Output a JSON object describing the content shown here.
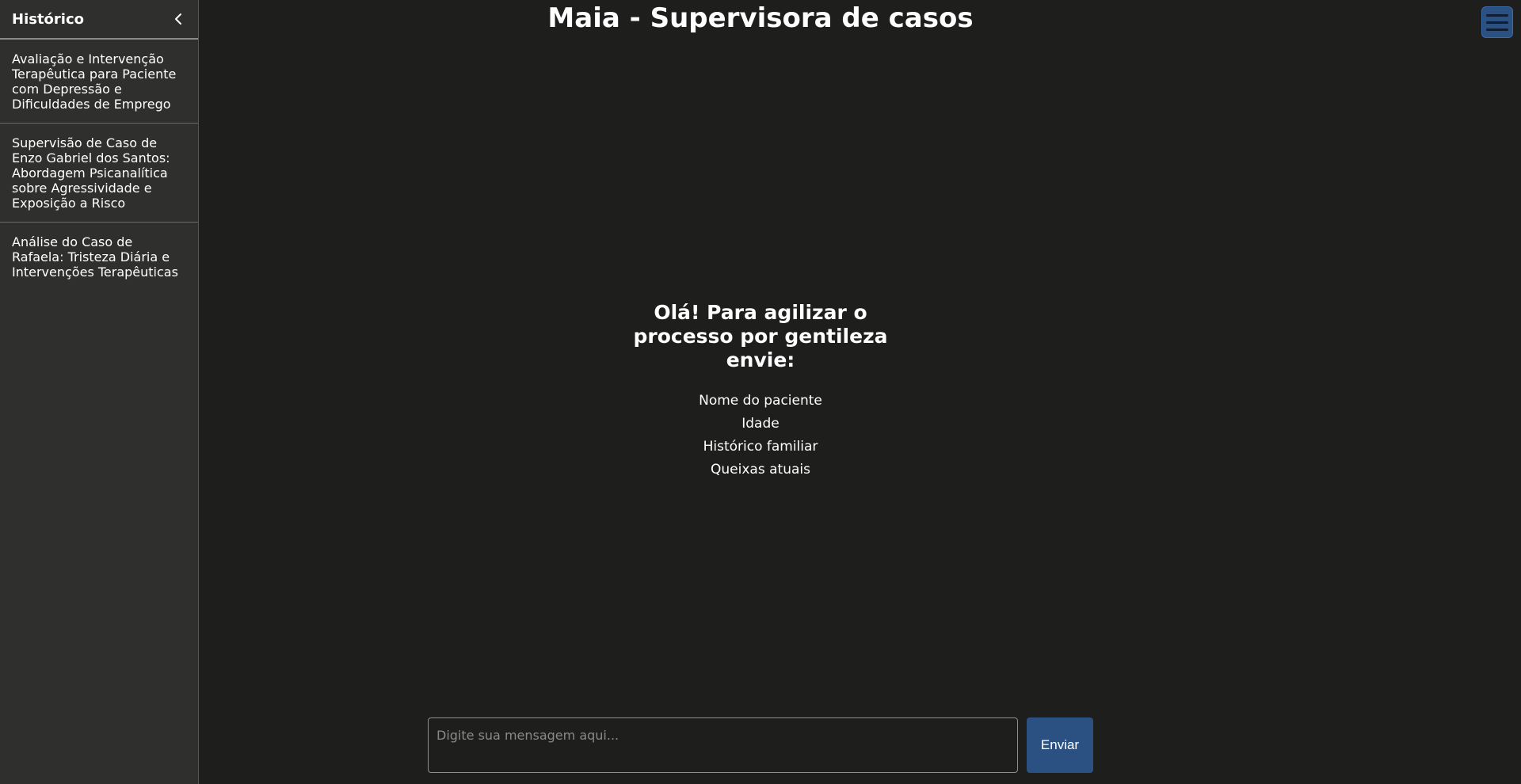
{
  "sidebar": {
    "title": "Histórico",
    "collapse_icon": "chevron-left-icon",
    "items": [
      {
        "label": "Avaliação e Intervenção Terapêutica para Paciente com Depressão e Dificuldades de Emprego"
      },
      {
        "label": "Supervisão de Caso de Enzo Gabriel dos Santos: Abordagem Psicanalítica sobre Agressividade e Exposição a Risco"
      },
      {
        "label": "Análise do Caso de Rafaela: Tristeza Diária e Intervenções Terapêuticas"
      }
    ]
  },
  "header": {
    "title": "Maia - Supervisora de casos",
    "menu_icon": "hamburger-menu-icon"
  },
  "welcome": {
    "heading": "Olá! Para agilizar o processo por gentileza envie:",
    "items": [
      "Nome do paciente",
      "Idade",
      "Histórico familiar",
      "Queixas atuais"
    ]
  },
  "composer": {
    "placeholder": "Digite sua mensagem aqui...",
    "value": "",
    "send_label": "Enviar"
  },
  "colors": {
    "background": "#1e1e1d",
    "sidebar": "#2f2f2e",
    "accent": "#2b5082",
    "text": "#ffffff"
  }
}
